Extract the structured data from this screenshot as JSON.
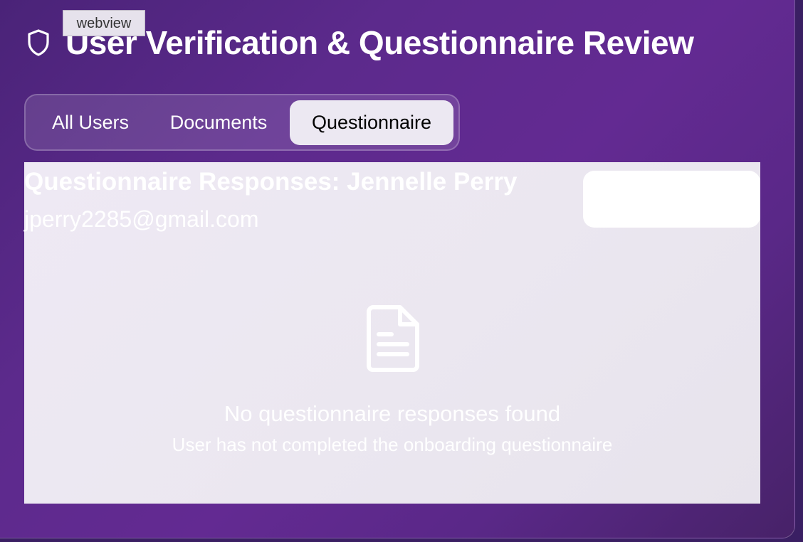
{
  "tooltip": {
    "label": "webview"
  },
  "header": {
    "icon": "shield-icon",
    "title": "User Verification & Questionnaire Review"
  },
  "tabs": [
    {
      "label": "All Users",
      "active": false
    },
    {
      "label": "Documents",
      "active": false
    },
    {
      "label": "Questionnaire",
      "active": true
    }
  ],
  "panel": {
    "title": "Questionnaire Responses: Jennelle Perry",
    "email": "jperry2285@gmail.com",
    "empty_state": {
      "icon": "document-icon",
      "title": "No questionnaire responses found",
      "subtitle": "User has not completed the onboarding questionnaire"
    }
  },
  "colors": {
    "background_gradient_start": "#4a2378",
    "background_gradient_mid": "#632a92",
    "active_tab_bg": "#ece8f2",
    "panel_bg": "#ebe7f0"
  }
}
